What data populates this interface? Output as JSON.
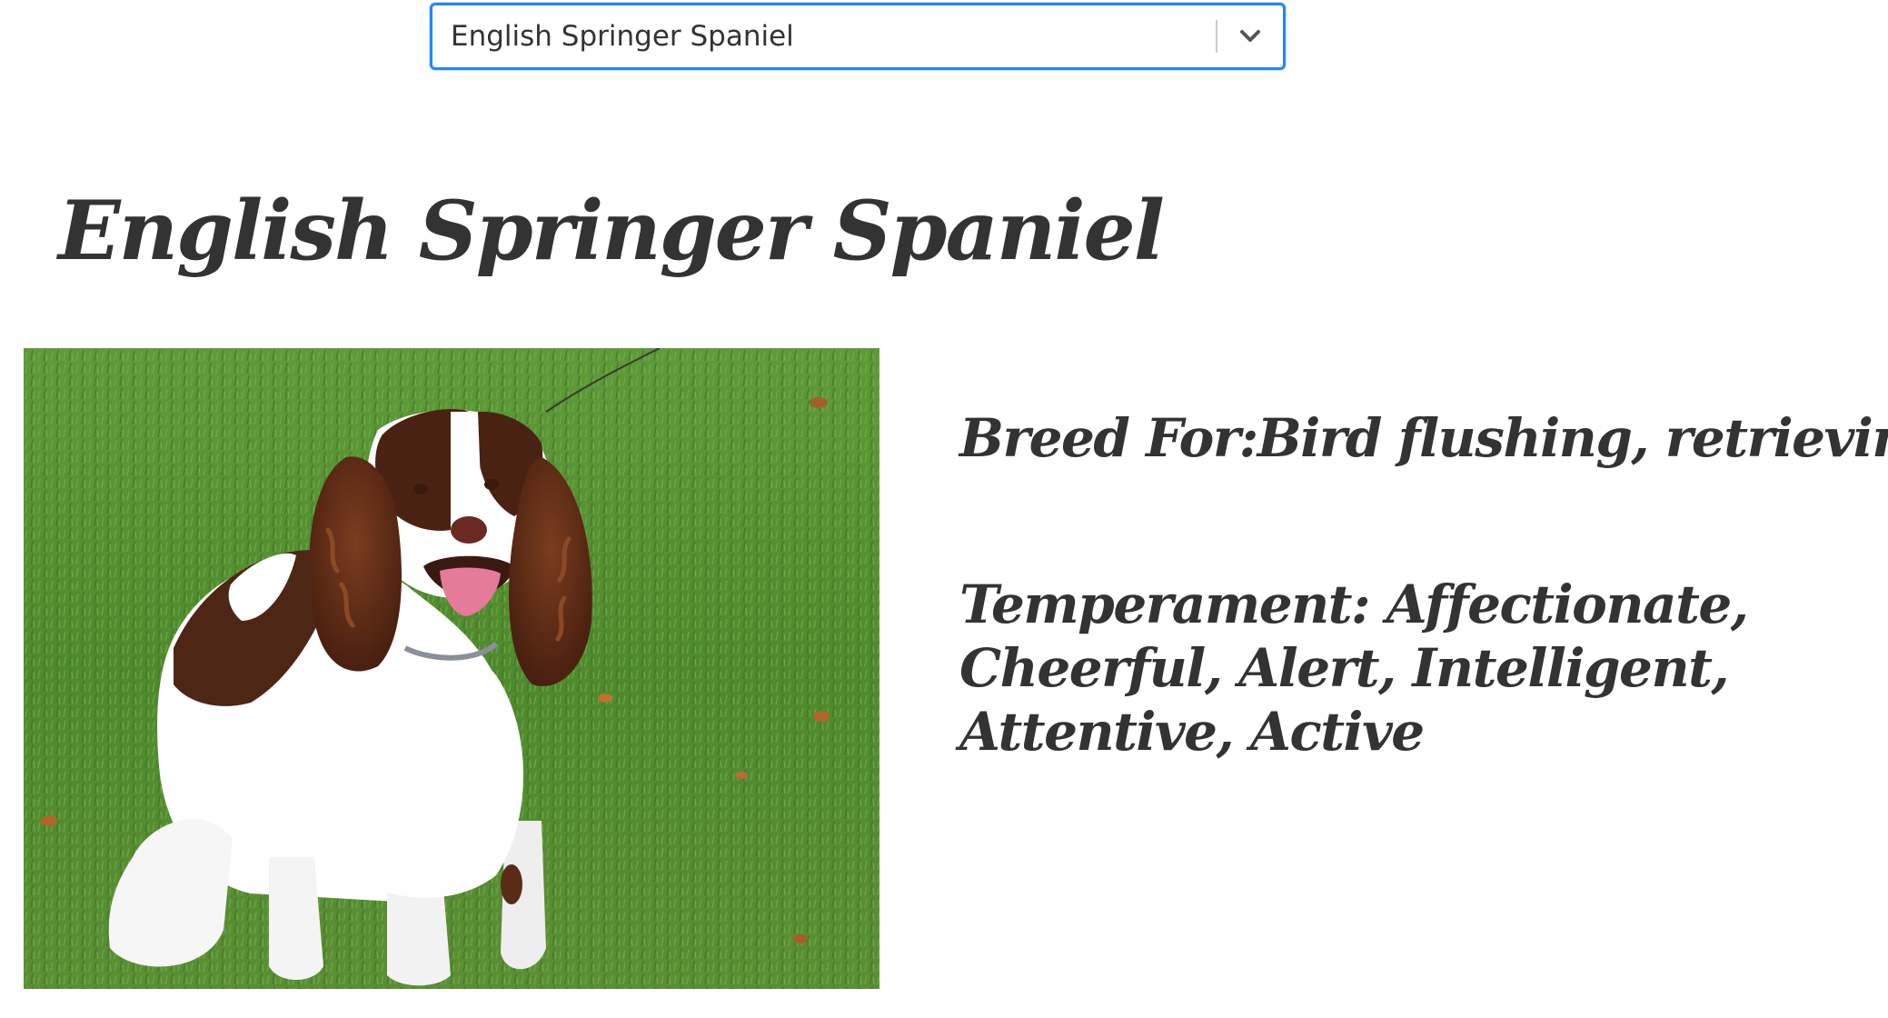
{
  "breed_select": {
    "selected_value": "English Springer Spaniel",
    "accent_color": "#2684ff",
    "chevron_icon": "chevron-down-icon"
  },
  "breed": {
    "name": "English Springer Spaniel",
    "bred_for_text": "Breed For:Bird flushing, retrieving",
    "temperament_text": "Temperament: Affectionate, Cheerful, Alert, Intelligent, Attentive, Active"
  }
}
